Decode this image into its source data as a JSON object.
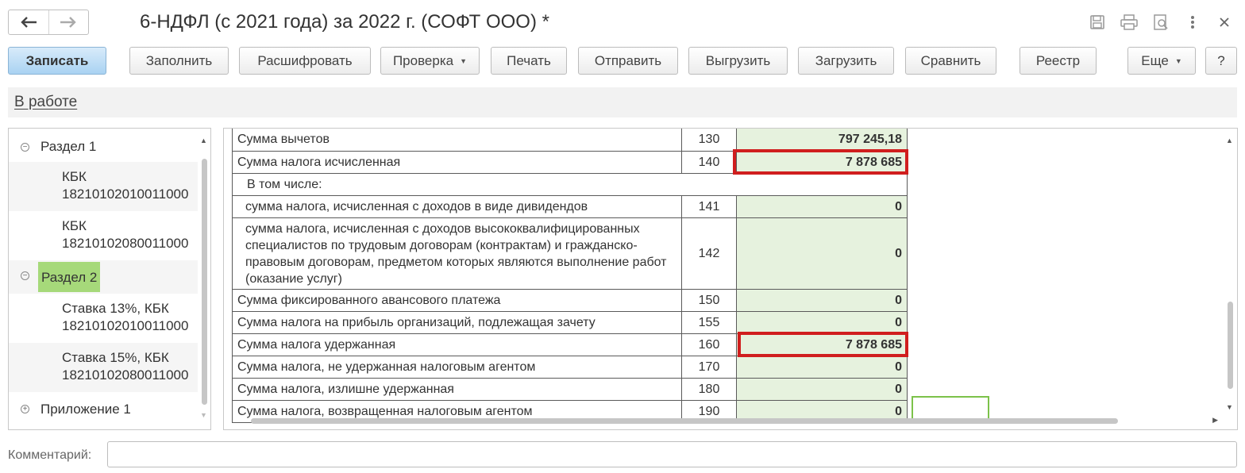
{
  "window": {
    "title": "6-НДФЛ (с 2021 года) за 2022 г. (СОФТ ООО) *",
    "icons": [
      "save-icon",
      "print-icon",
      "preview-icon",
      "more-icon",
      "close-icon"
    ]
  },
  "toolbar": {
    "buttons": [
      {
        "label": "Записать",
        "primary": true
      },
      {
        "label": "Заполнить"
      },
      {
        "label": "Расшифровать"
      },
      {
        "label": "Проверка",
        "dropdown": true
      },
      {
        "label": "Печать"
      },
      {
        "label": "Отправить"
      },
      {
        "label": "Выгрузить"
      },
      {
        "label": "Загрузить"
      },
      {
        "label": "Сравнить"
      },
      {
        "label": "Реестр"
      },
      {
        "label": "Еще",
        "dropdown": true
      },
      {
        "label": "?"
      }
    ]
  },
  "status": {
    "link": "В работе"
  },
  "tree": {
    "items": [
      {
        "label": "Раздел 1",
        "toggle": "⊖"
      },
      {
        "label": "КБК\n18210102010011000"
      },
      {
        "label": "КБК\n18210102080011000"
      },
      {
        "label": "Раздел 2",
        "toggle": "⊖",
        "selected": true
      },
      {
        "label": "Ставка 13%, КБК\n18210102010011000"
      },
      {
        "label": "Ставка 15%, КБК\n18210102080011000"
      },
      {
        "label": "Приложение 1",
        "toggle": "⊕"
      }
    ]
  },
  "form": {
    "rows": [
      {
        "label": "Сумма вычетов",
        "code": "130",
        "value": "797 245,18"
      },
      {
        "label": "Сумма налога исчисленная",
        "code": "140",
        "value": "7 878 685",
        "highlighted": true
      },
      {
        "label": "В том числе:"
      },
      {
        "label": "сумма налога, исчисленная с доходов в виде дивидендов",
        "code": "141",
        "value": "0"
      },
      {
        "label": "сумма налога, исчисленная с доходов высококвалифицированных специалистов по трудовым договорам (контрактам) и гражданско-правовым договорам, предметом которых являются выполнение работ (оказание услуг)",
        "code": "142",
        "value": "0"
      },
      {
        "label": "Сумма фиксированного авансового платежа",
        "code": "150",
        "value": "0"
      },
      {
        "label": "Сумма налога на прибыль организаций, подлежащая зачету",
        "code": "155",
        "value": "0"
      },
      {
        "label": "Сумма налога удержанная",
        "code": "160",
        "value": "7 878 685",
        "highlighted": true
      },
      {
        "label": "Сумма налога, не удержанная налоговым агентом",
        "code": "170",
        "value": "0"
      },
      {
        "label": "Сумма налога, излишне удержанная",
        "code": "180",
        "value": "0"
      },
      {
        "label": "Сумма налога, возвращенная налоговым агентом",
        "code": "190",
        "value": "0"
      }
    ]
  },
  "comment": {
    "label": "Комментарий:",
    "value": ""
  }
}
